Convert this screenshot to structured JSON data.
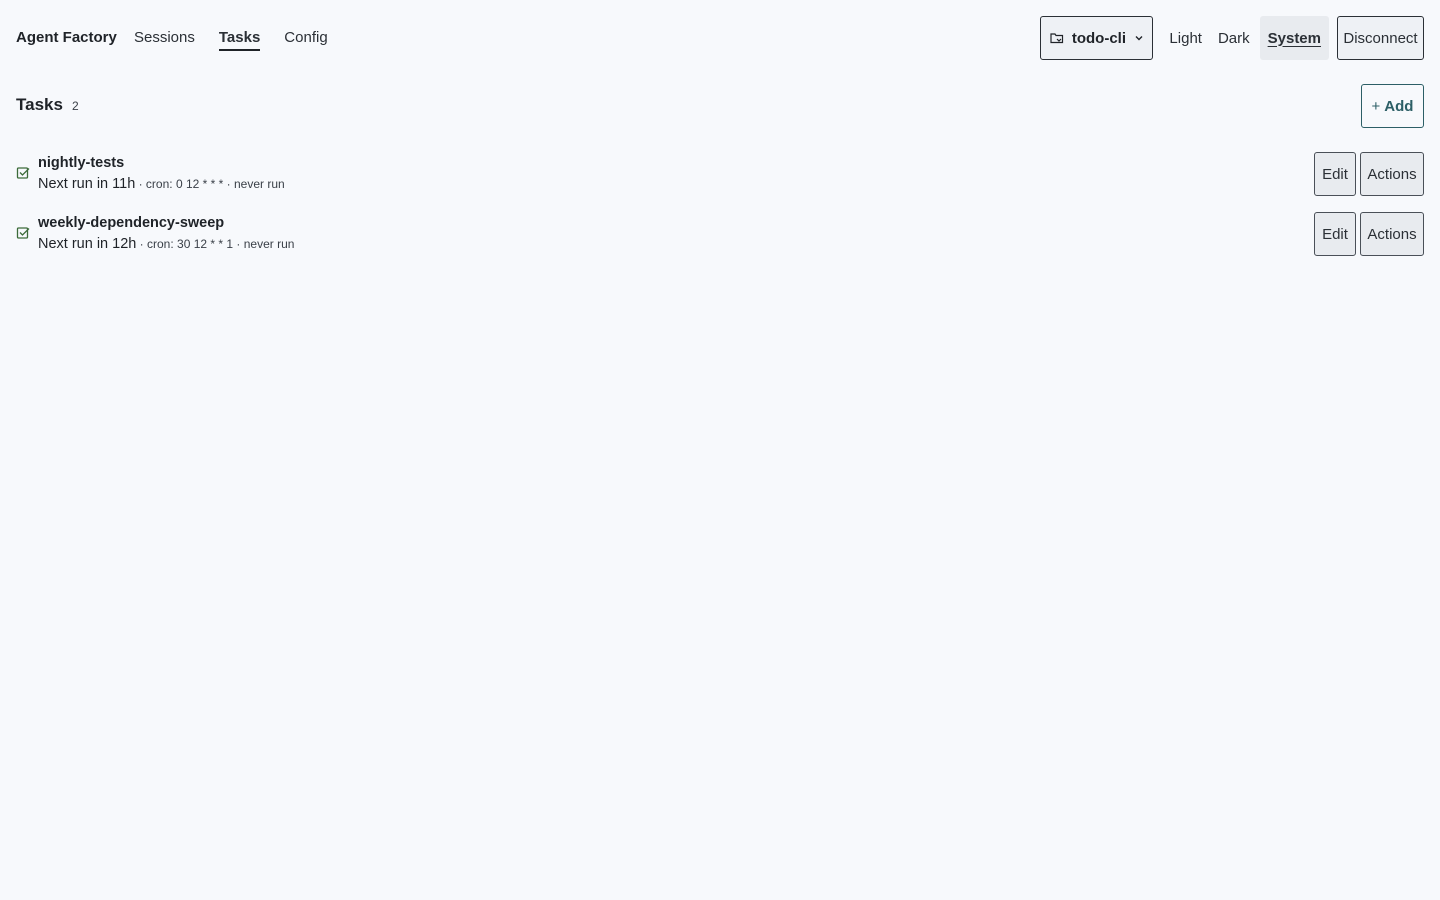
{
  "header": {
    "brand": "Agent Factory",
    "nav": [
      {
        "label": "Sessions",
        "active": false
      },
      {
        "label": "Tasks",
        "active": true
      },
      {
        "label": "Config",
        "active": false
      }
    ],
    "project": "todo-cli",
    "themes": [
      "Light",
      "Dark",
      "System"
    ],
    "active_theme": "System",
    "disconnect_label": "Disconnect"
  },
  "tasks_section": {
    "title": "Tasks",
    "count": "2",
    "add_label": "Add",
    "add_icon": "+"
  },
  "tasks": [
    {
      "name": "nightly-tests",
      "next_run": "Next run in 11h",
      "details": " · cron: 0 12 * * * · never run",
      "edit_label": "Edit",
      "actions_label": "Actions"
    },
    {
      "name": "weekly-dependency-sweep",
      "next_run": "Next run in 12h",
      "details": " · cron: 30 12 * * 1 · never run",
      "edit_label": "Edit",
      "actions_label": "Actions"
    }
  ],
  "colors": {
    "background": "#f7f9fc",
    "accent": "#2c5f66",
    "check": "#3c6b3a"
  }
}
